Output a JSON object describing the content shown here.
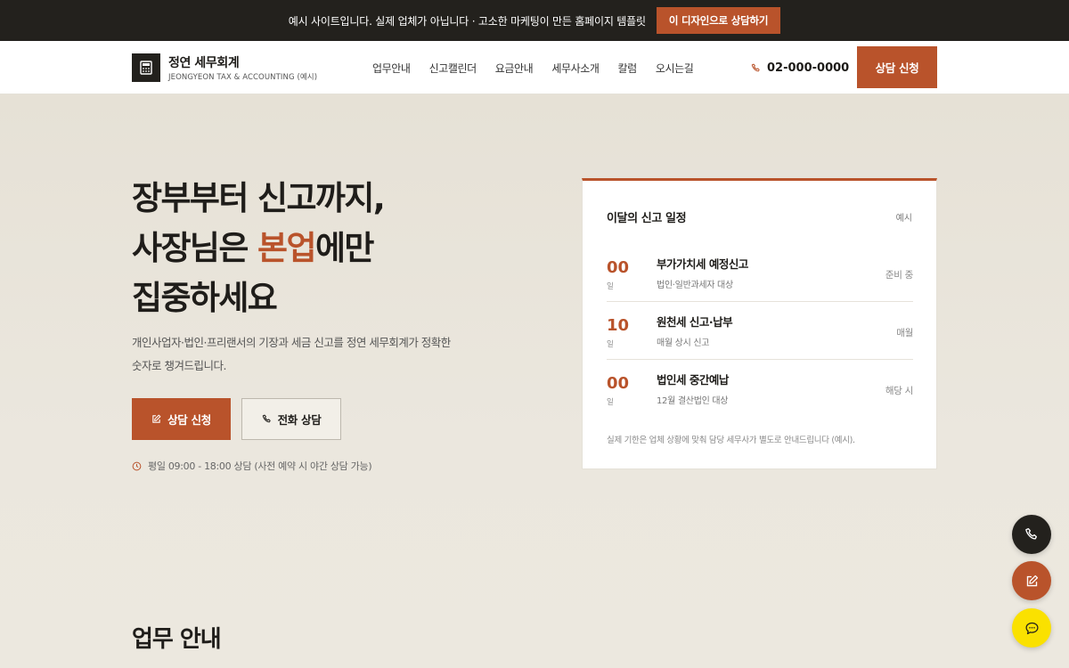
{
  "topbar": {
    "notice": "예시 사이트입니다. 실제 업체가 아닙니다 · 고소한 마케팅이 만든 홈페이지 템플릿",
    "cta_label": "이 디자인으로 상담하기"
  },
  "brand": {
    "name": "정연 세무회계",
    "subtitle": "JEONGYEON TAX & ACCOUNTING (예시)",
    "icon": "calculator-icon"
  },
  "nav": {
    "items": [
      "업무안내",
      "신고캘린더",
      "요금안내",
      "세무사소개",
      "칼럼",
      "오시는길"
    ],
    "phone": "02-000-0000",
    "cta_label": "상담 신청"
  },
  "hero": {
    "title_line1": "장부부터 신고까지,",
    "title_line2_pre": "사장님은 ",
    "title_line2_accent": "본업",
    "title_line2_post": "에만",
    "title_line3": "집중하세요",
    "desc_line1": "개인사업자·법인·프리랜서의 기장과 세금 신고를 정연 세무회계가 정확한",
    "desc_line2": "숫자로 챙겨드립니다.",
    "primary_label": "상담 신청",
    "secondary_label": "전화 상담",
    "hours": "평일 09:00 - 18:00 상담 (사전 예약 시 야간 상담 가능)"
  },
  "schedule": {
    "title": "이달의 신고 일정",
    "tag": "예시",
    "rows": [
      {
        "day": "00",
        "unit": "일",
        "name": "부가가치세 예정신고",
        "target": "법인·일반과세자 대상",
        "status": "준비 중"
      },
      {
        "day": "10",
        "unit": "일",
        "name": "원천세 신고·납부",
        "target": "매월 상시 신고",
        "status": "매월"
      },
      {
        "day": "00",
        "unit": "일",
        "name": "법인세 중간예납",
        "target": "12월 결산법인 대상",
        "status": "해당 시"
      }
    ],
    "note": "실제 기한은 업체 상황에 맞춰 담당 세무사가 별도로 안내드립니다 (예시)."
  },
  "services": {
    "title": "업무 안내"
  },
  "colors": {
    "accent": "#b9532b",
    "dark": "#23211d",
    "kakao": "#fae100"
  }
}
